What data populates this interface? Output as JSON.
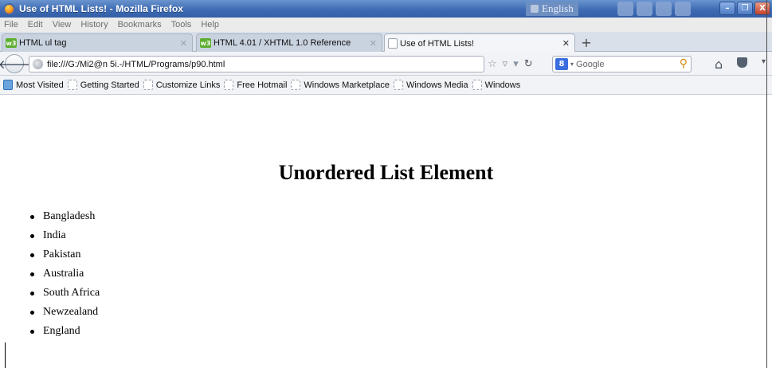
{
  "window": {
    "title": "Use of HTML Lists! - Mozilla Firefox",
    "language": "English",
    "controls": {
      "minimize": "–",
      "restore": "❐",
      "close": "X"
    }
  },
  "menu": [
    "File",
    "Edit",
    "View",
    "History",
    "Bookmarks",
    "Tools",
    "Help"
  ],
  "tabs": [
    {
      "label": "HTML ul tag",
      "favicon": "w3schools-icon",
      "active": false
    },
    {
      "label": "HTML 4.01 / XHTML 1.0 Reference",
      "favicon": "w3schools-icon",
      "active": false
    },
    {
      "label": "Use of HTML Lists!",
      "favicon": "blank-page-icon",
      "active": true
    }
  ],
  "navbar": {
    "url": "file:///G:/Mi2@n 5i.-/HTML/Programs/p90.html",
    "search_placeholder": "Google",
    "search_engine_letter": "8"
  },
  "bookmarks": [
    "Most Visited",
    "Getting Started",
    "Customize Links",
    "Free Hotmail",
    "Windows Marketplace",
    "Windows Media",
    "Windows"
  ],
  "page": {
    "heading": "Unordered List Element",
    "items": [
      "Bangladesh",
      "India",
      "Pakistan",
      "Australia",
      "South Africa",
      "Newzealand",
      "England"
    ]
  }
}
